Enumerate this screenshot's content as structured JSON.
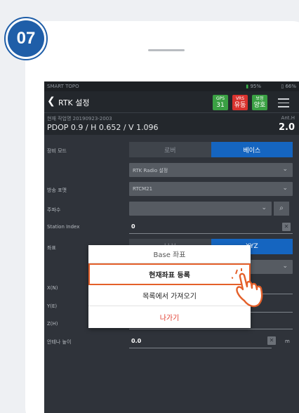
{
  "step": {
    "number": "07"
  },
  "status_bar": {
    "app_name": "SMART TOPO",
    "battery_device": "95%",
    "battery_receiver": "66%"
  },
  "app_bar": {
    "title": "RTK 설정",
    "chips": [
      {
        "label": "GPS",
        "value": "31",
        "color": "#3aa043"
      },
      {
        "label": "VRS",
        "value": "유동",
        "color": "#d9322e"
      },
      {
        "label": "보정",
        "value": "양호",
        "color": "#3aa043"
      }
    ]
  },
  "info_bar": {
    "job": "현재 작업명 20190923-2003",
    "pdop": "PDOP 0.9 / H 0.652 / V 1.096",
    "ant_label": "Ant.H",
    "ant_value": "2.0"
  },
  "form": {
    "device_mode": {
      "label": "장비 모드",
      "options": [
        "로버",
        "베이스"
      ],
      "selected": "베이스"
    },
    "radio_setting": {
      "value": "RTK Radio 설정"
    },
    "broadcast_format": {
      "label": "방송 포맷",
      "value": "RTCM21"
    },
    "frequency": {
      "label": "주파수",
      "value": ""
    },
    "station_index": {
      "label": "Station Index",
      "value": "0"
    },
    "coordinate": {
      "label": "좌표",
      "options": [
        "LLH",
        "XYZ"
      ]
    },
    "x": {
      "label": "X(N)"
    },
    "y": {
      "label": "Y(E)"
    },
    "z": {
      "label": "Z(H)"
    },
    "antenna_height": {
      "label": "안테나 높이",
      "value": "0.0",
      "unit": "m"
    }
  },
  "dialog": {
    "title": "Base 좌표",
    "options": [
      "현재좌표 등록",
      "목록에서 가져오기"
    ],
    "cancel": "나가기"
  }
}
